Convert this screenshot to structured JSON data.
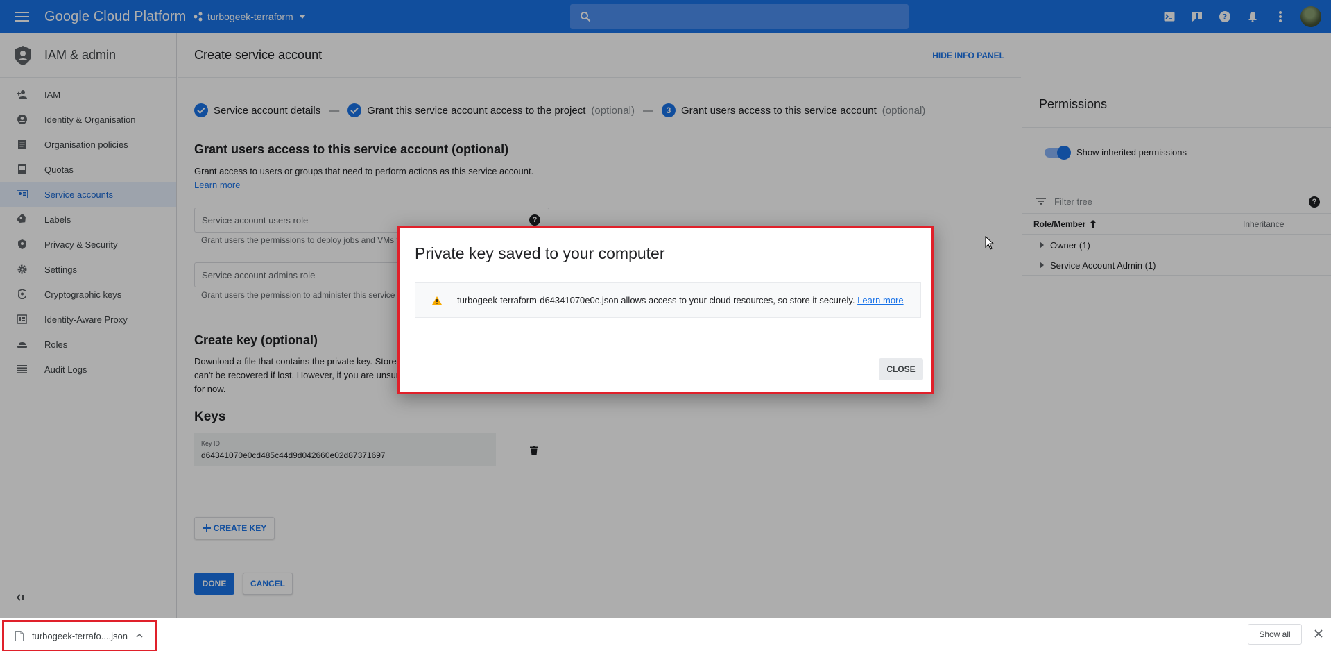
{
  "topbar": {
    "brand": "Google Cloud Platform",
    "project": "turbogeek-terraform"
  },
  "sidebar": {
    "title": "IAM & admin",
    "items": [
      {
        "label": "IAM",
        "icon": "person-add-icon"
      },
      {
        "label": "Identity & Organisation",
        "icon": "account-circle-icon"
      },
      {
        "label": "Organisation policies",
        "icon": "policy-doc-icon"
      },
      {
        "label": "Quotas",
        "icon": "quota-icon"
      },
      {
        "label": "Service accounts",
        "icon": "service-account-icon"
      },
      {
        "label": "Labels",
        "icon": "label-icon"
      },
      {
        "label": "Privacy & Security",
        "icon": "shield-icon"
      },
      {
        "label": "Settings",
        "icon": "gear-icon"
      },
      {
        "label": "Cryptographic keys",
        "icon": "crypto-shield-icon"
      },
      {
        "label": "Identity-Aware Proxy",
        "icon": "proxy-icon"
      },
      {
        "label": "Roles",
        "icon": "roles-icon"
      },
      {
        "label": "Audit Logs",
        "icon": "list-icon"
      }
    ]
  },
  "main": {
    "title": "Create service account",
    "hide_info": "HIDE INFO PANEL",
    "steps": {
      "s1": "Service account details",
      "s2": "Grant this service account access to the project",
      "s2_opt": "(optional)",
      "s3_num": "3",
      "s3": "Grant users access to this service account",
      "s3_opt": "(optional)",
      "dash": "—"
    },
    "grant_title": "Grant users access to this service account (optional)",
    "grant_desc": "Grant access to users or groups that need to perform actions as this service account.",
    "learn_more": "Learn more",
    "users_role_placeholder": "Service account users role",
    "users_role_hint": "Grant users the permissions to deploy jobs and VMs w",
    "admins_role_placeholder": "Service account admins role",
    "admins_role_hint": "Grant users the permission to administer this service",
    "create_key_title": "Create key (optional)",
    "create_key_desc1": "Download a file that contains the private key. Store",
    "create_key_desc2": "can't be recovered if lost. However, if you are unsur",
    "create_key_desc3": "for now.",
    "keys_title": "Keys",
    "key_id_label": "Key ID",
    "key_id_value": "d64341070e0cd485c44d9d042660e02d87371697",
    "create_key_btn": "CREATE KEY",
    "done_btn": "DONE",
    "cancel_btn": "CANCEL"
  },
  "panel": {
    "title": "Permissions",
    "toggle_label": "Show inherited permissions",
    "filter_placeholder": "Filter tree",
    "col_role": "Role/Member",
    "col_inherit": "Inheritance",
    "rows": [
      "Owner (1)",
      "Service Account Admin (1)"
    ]
  },
  "dialog": {
    "title": "Private key saved to your computer",
    "message": "turbogeek-terraform-d64341070e0c.json allows access to your cloud resources, so store it securely.",
    "learn_more": "Learn more",
    "close": "CLOSE"
  },
  "shelf": {
    "filename": "turbogeek-terrafo....json",
    "show_all": "Show all"
  },
  "colors": {
    "brand_blue": "#1a73e8",
    "highlight_red": "#e0202a"
  }
}
